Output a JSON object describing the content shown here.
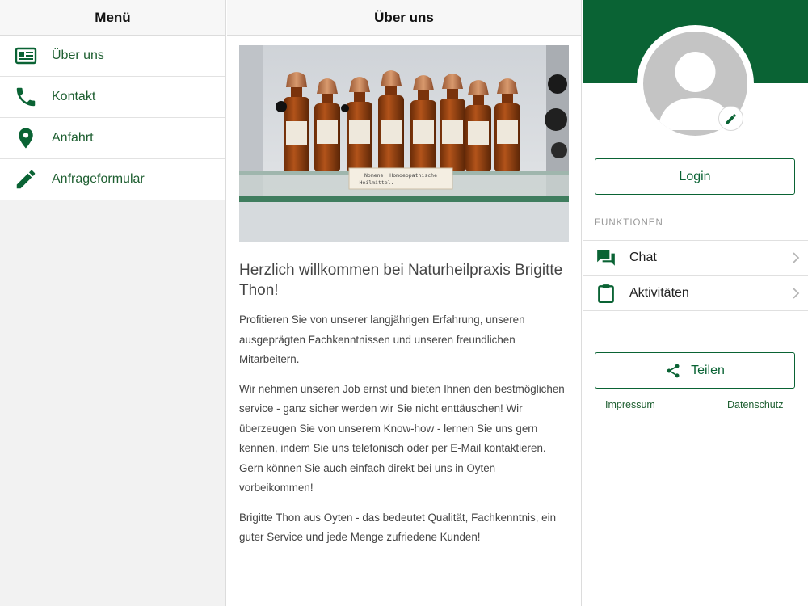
{
  "menu": {
    "title": "Menü",
    "items": [
      {
        "label": "Über uns",
        "icon": "newspaper-icon"
      },
      {
        "label": "Kontakt",
        "icon": "phone-icon"
      },
      {
        "label": "Anfahrt",
        "icon": "map-pin-icon"
      },
      {
        "label": "Anfrageformular",
        "icon": "pencil-icon"
      }
    ]
  },
  "main": {
    "title": "Über uns",
    "hero_label_line1": "Nomene: Homoeopathische",
    "hero_label_line2": "Heilmittel.",
    "heading": "Herzlich willkommen bei Naturheilpraxis Brigitte Thon!",
    "paragraphs": [
      "Profitieren Sie von unserer langjährigen Erfahrung, unseren ausgeprägten Fachkenntnissen und unseren freundlichen Mitarbeitern.",
      "Wir nehmen unseren Job ernst und bieten Ihnen den bestmöglichen service - ganz sicher werden wir Sie nicht enttäuschen! Wir überzeugen Sie von unserem Know-how - lernen Sie uns gern kennen, indem Sie uns telefonisch oder per E-Mail kontaktieren. Gern können Sie auch einfach direkt bei uns in Oyten vorbeikommen!",
      "Brigitte Thon aus Oyten - das bedeutet Qualität, Fachkenntnis, ein guter Service und jede Menge zufriedene Kunden!"
    ]
  },
  "sidebar": {
    "login_label": "Login",
    "section_label": "FUNKTIONEN",
    "functions": [
      {
        "label": "Chat",
        "icon": "chat-icon"
      },
      {
        "label": "Aktivitäten",
        "icon": "clipboard-icon"
      }
    ],
    "share_label": "Teilen",
    "impressum": "Impressum",
    "datenschutz": "Datenschutz"
  },
  "colors": {
    "brand_green": "#0a6334",
    "link_green": "#1d5e30"
  }
}
